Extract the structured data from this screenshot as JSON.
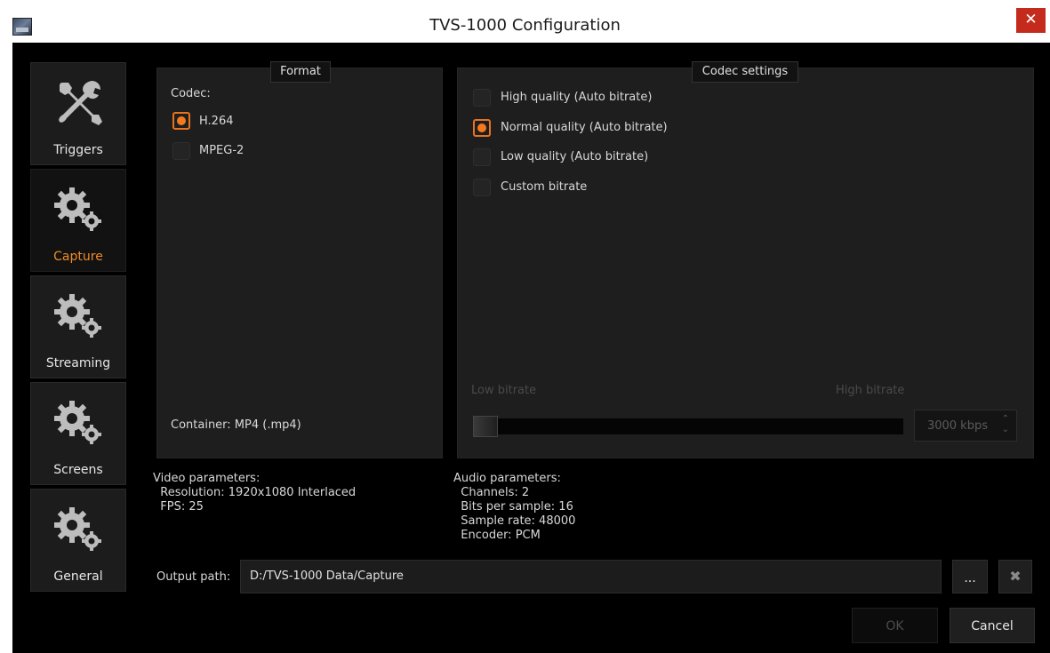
{
  "window": {
    "title": "TVS-1000 Configuration",
    "close_symbol": "✕"
  },
  "sidebar": {
    "items": [
      {
        "label": "Triggers",
        "icon": "tools-icon",
        "active": false
      },
      {
        "label": "Capture",
        "icon": "gears-icon",
        "active": true
      },
      {
        "label": "Streaming",
        "icon": "gears-icon",
        "active": false
      },
      {
        "label": "Screens",
        "icon": "gears-icon",
        "active": false
      },
      {
        "label": "General",
        "icon": "gears-icon",
        "active": false
      }
    ]
  },
  "format": {
    "title": "Format",
    "codec_label": "Codec:",
    "codecs": [
      {
        "label": "H.264",
        "selected": true
      },
      {
        "label": "MPEG-2",
        "selected": false
      }
    ],
    "container": "Container:  MP4 (.mp4)"
  },
  "codec_settings": {
    "title": "Codec settings",
    "options": [
      {
        "label": "High quality (Auto bitrate)",
        "selected": false
      },
      {
        "label": "Normal quality (Auto bitrate)",
        "selected": true
      },
      {
        "label": "Low quality (Auto bitrate)",
        "selected": false
      },
      {
        "label": "Custom bitrate",
        "selected": false
      }
    ],
    "low_label": "Low bitrate",
    "high_label": "High bitrate",
    "bitrate_value": "3000 kbps",
    "spin_up": "⌃",
    "spin_down": "⌄"
  },
  "video_params": {
    "title": "Video parameters:",
    "lines": [
      "Resolution: 1920x1080 Interlaced",
      "FPS: 25"
    ]
  },
  "audio_params": {
    "title": "Audio parameters:",
    "lines": [
      "Channels: 2",
      "Bits per sample: 16",
      "Sample rate: 48000",
      "Encoder: PCM"
    ]
  },
  "output": {
    "label": "Output path:",
    "value": "D:/TVS-1000 Data/Capture",
    "browse_label": "...",
    "clear_symbol": "✖"
  },
  "footer": {
    "ok_label": "OK",
    "cancel_label": "Cancel"
  },
  "colors": {
    "accent": "#f47a1f",
    "close": "#c42b1c"
  }
}
